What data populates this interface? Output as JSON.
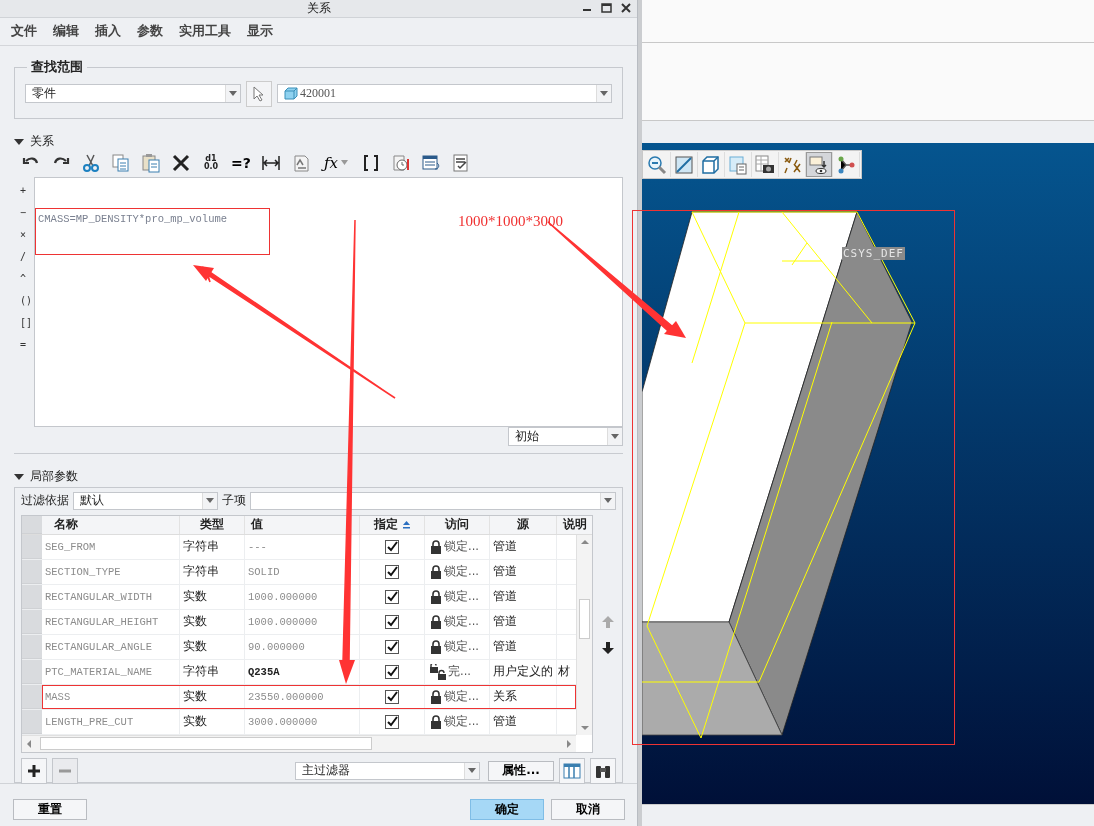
{
  "window": {
    "title": "关系"
  },
  "menu": [
    "文件",
    "编辑",
    "插入",
    "参数",
    "实用工具",
    "显示"
  ],
  "scope": {
    "title": "查找范围",
    "type_value": "零件",
    "model_value": "420001"
  },
  "relations": {
    "title": "关系",
    "expanded": true,
    "toolbar": [
      {
        "kind": "undo"
      },
      {
        "kind": "redo"
      },
      {
        "kind": "cut"
      },
      {
        "kind": "copy"
      },
      {
        "kind": "paste"
      },
      {
        "kind": "delete"
      },
      {
        "kind": "dim-info",
        "lines": [
          "d1",
          "0.0"
        ]
      },
      {
        "kind": "text",
        "label": "=?"
      },
      {
        "kind": "measure"
      },
      {
        "kind": "units"
      },
      {
        "kind": "function",
        "label": "ƒx"
      },
      {
        "kind": "brackets"
      },
      {
        "kind": "verify"
      },
      {
        "kind": "sort"
      },
      {
        "kind": "report"
      }
    ],
    "operators": [
      "+",
      "−",
      "×",
      "/",
      "^",
      "()",
      "[]",
      "="
    ],
    "lines": [
      "CMASS=MP_DENSITY*pro_mp_volume"
    ],
    "order": "初始"
  },
  "local_params": {
    "title": "局部参数",
    "expanded": true,
    "filter_label": "过滤依据",
    "filter_value": "默认",
    "child_label": "子项",
    "columns": [
      {
        "label": "名称",
        "sorted": false
      },
      {
        "label": "类型",
        "sorted": false
      },
      {
        "label": "值",
        "sorted": false
      },
      {
        "label": "指定",
        "sorted": true
      },
      {
        "label": "访问",
        "sorted": false
      },
      {
        "label": "源",
        "sorted": false
      },
      {
        "label": "说明",
        "sorted": false
      }
    ],
    "rows": [
      {
        "name": "SEG_FROM",
        "type": "字符串",
        "value": "---",
        "specified": true,
        "locked": true,
        "access": "锁定...",
        "source": "管道",
        "marked": false
      },
      {
        "name": "SECTION_TYPE",
        "type": "字符串",
        "value": "SOLID",
        "specified": true,
        "locked": true,
        "access": "锁定...",
        "source": "管道",
        "marked": false
      },
      {
        "name": "RECTANGULAR_WIDTH",
        "type": "实数",
        "value": "1000.000000",
        "specified": true,
        "locked": true,
        "access": "锁定...",
        "source": "管道",
        "marked": false
      },
      {
        "name": "RECTANGULAR_HEIGHT",
        "type": "实数",
        "value": "1000.000000",
        "specified": true,
        "locked": true,
        "access": "锁定...",
        "source": "管道",
        "marked": false
      },
      {
        "name": "RECTANGULAR_ANGLE",
        "type": "实数",
        "value": "90.000000",
        "specified": true,
        "locked": true,
        "access": "锁定...",
        "source": "管道",
        "marked": false
      },
      {
        "name": "PTC_MATERIAL_NAME",
        "type": "字符串",
        "value": "Q235A",
        "specified": true,
        "locked": false,
        "access": "完...",
        "source": "用户定义的",
        "description": "材",
        "marked": false
      },
      {
        "name": "MASS",
        "type": "实数",
        "value": "23550.000000",
        "specified": true,
        "locked": true,
        "access": "锁定...",
        "source": "关系",
        "marked": true
      },
      {
        "name": "LENGTH_PRE_CUT",
        "type": "实数",
        "value": "3000.000000",
        "specified": true,
        "locked": true,
        "access": "锁定...",
        "source": "管道",
        "marked": false
      }
    ],
    "filter": "主过滤器",
    "properties_button": "属性..."
  },
  "buttons": [
    {
      "label": "重置",
      "primary": false
    },
    {
      "label": "确定",
      "primary": true
    },
    {
      "label": "取消",
      "primary": false
    }
  ],
  "viewport": {
    "toolbar": [
      {
        "kind": "zoom-out",
        "pressed": false
      },
      {
        "kind": "refit",
        "pressed": false
      },
      {
        "kind": "cube",
        "pressed": false
      },
      {
        "kind": "views",
        "pressed": false
      },
      {
        "kind": "camera",
        "pressed": false
      },
      {
        "kind": "datum",
        "pressed": false
      },
      {
        "kind": "display",
        "pressed": true
      },
      {
        "kind": "graph",
        "pressed": false
      }
    ],
    "csys_label": "CSYS_DEF"
  },
  "annotation": {
    "note": "1000*1000*3000"
  }
}
